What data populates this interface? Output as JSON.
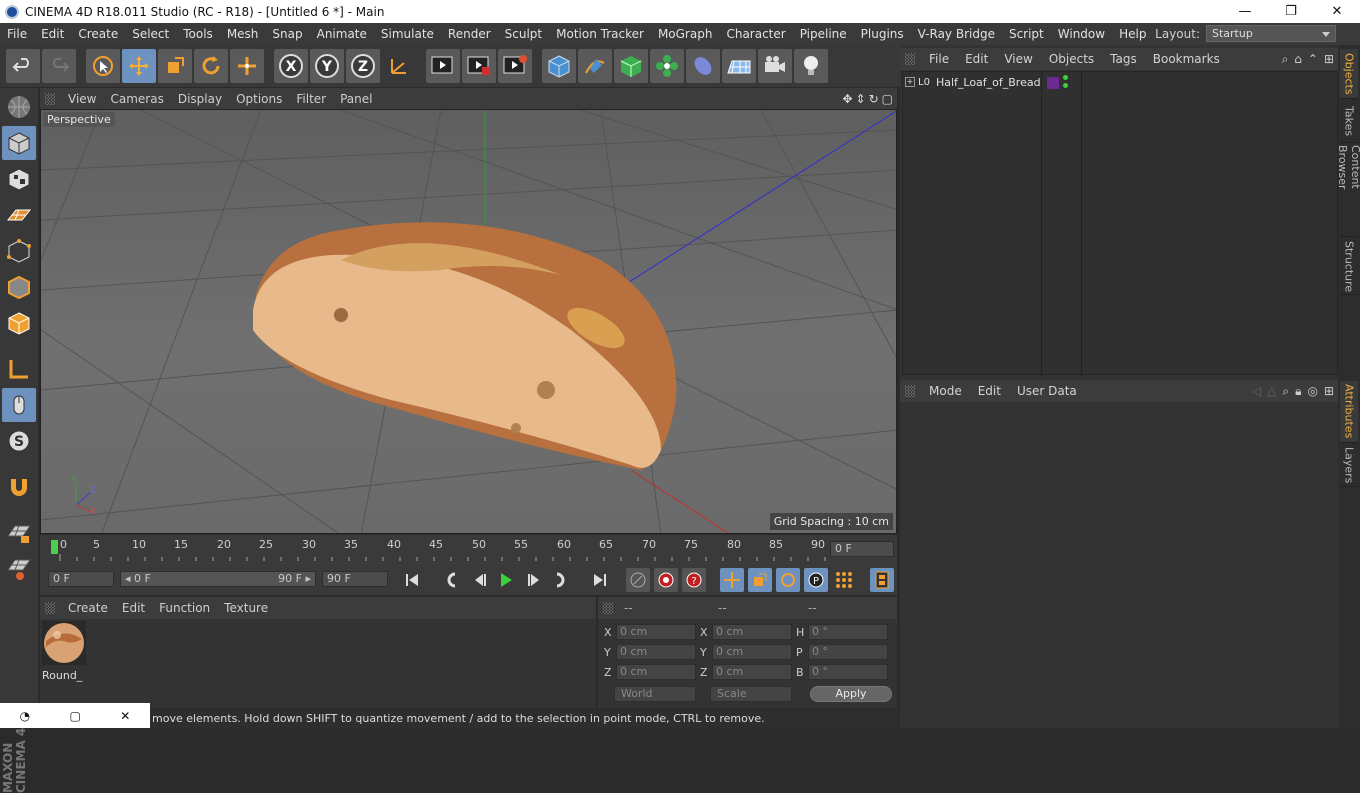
{
  "window": {
    "title": "CINEMA 4D R18.011 Studio (RC - R18) - [Untitled 6 *] - Main",
    "buttons": [
      "—",
      "❐",
      "✕"
    ]
  },
  "menubar": {
    "items": [
      "File",
      "Edit",
      "Create",
      "Select",
      "Tools",
      "Mesh",
      "Snap",
      "Animate",
      "Simulate",
      "Render",
      "Sculpt",
      "Motion Tracker",
      "MoGraph",
      "Character",
      "Pipeline",
      "Plugins",
      "V-Ray Bridge",
      "Script",
      "Window",
      "Help"
    ],
    "layout_label": "Layout:",
    "layout_value": "Startup"
  },
  "toolbar": {
    "icons": [
      "undo-icon",
      "redo-icon",
      "select-icon",
      "move-icon",
      "scale-icon",
      "rotate-icon",
      "live-selection-icon",
      "x-axis-icon",
      "y-axis-icon",
      "z-axis-icon",
      "coordinate-system-icon",
      "render-view-icon",
      "render-picture-viewer-icon",
      "edit-render-settings-icon",
      "cube-icon",
      "pen-icon",
      "subdivision-icon",
      "cloner-icon",
      "deformer-icon",
      "floor-icon",
      "camera-icon",
      "light-icon"
    ],
    "axis_labels": [
      "X",
      "Y",
      "Z"
    ]
  },
  "left_toolbar": {
    "icons": [
      "make-editable-icon",
      "model-mode-icon",
      "texture-mode-icon",
      "workplane-icon",
      "points-mode-icon",
      "edges-mode-icon",
      "polygons-mode-icon",
      "axis-mode-icon",
      "tweak-mode-icon",
      "soft-selection-icon",
      "snap-icon",
      "locked-workplane-icon",
      "planar-workplane-icon"
    ],
    "brand": "MAXON CINEMA 4D"
  },
  "viewport": {
    "menu": [
      "View",
      "Cameras",
      "Display",
      "Options",
      "Filter",
      "Panel"
    ],
    "camera_label": "Perspective",
    "grid_info": "Grid Spacing : 10 cm",
    "axis_labels": [
      "Y",
      "Z",
      "X"
    ]
  },
  "timeline": {
    "ticks": [
      "0",
      "5",
      "10",
      "15",
      "20",
      "25",
      "30",
      "35",
      "40",
      "45",
      "50",
      "55",
      "60",
      "65",
      "70",
      "75",
      "80",
      "85",
      "90"
    ],
    "current_frame": "0 F",
    "start_field": "0 F",
    "range_start": "◂ 0 F",
    "range_end": "90 F ▸",
    "end_field": "90 F"
  },
  "materials": {
    "menu": [
      "Create",
      "Edit",
      "Function",
      "Texture"
    ],
    "items": [
      {
        "name": "Round_"
      }
    ]
  },
  "coordinates": {
    "headers": [
      "--",
      "--",
      "--"
    ],
    "rows": [
      {
        "l1": "X",
        "v1": "0 cm",
        "l2": "X",
        "v2": "0 cm",
        "l3": "H",
        "v3": "0 °"
      },
      {
        "l1": "Y",
        "v1": "0 cm",
        "l2": "Y",
        "v2": "0 cm",
        "l3": "P",
        "v3": "0 °"
      },
      {
        "l1": "Z",
        "v1": "0 cm",
        "l2": "Z",
        "v2": "0 cm",
        "l3": "B",
        "v3": "0 °"
      }
    ],
    "world": "World",
    "scale": "Scale",
    "apply": "Apply"
  },
  "status": "move elements. Hold down SHIFT to quantize movement / add to the selection in point mode, CTRL to remove.",
  "object_manager": {
    "menu": [
      "File",
      "Edit",
      "View",
      "Objects",
      "Tags",
      "Bookmarks"
    ],
    "objects": [
      {
        "name": "Half_Loaf_of_Bread"
      }
    ]
  },
  "attribute_manager": {
    "menu": [
      "Mode",
      "Edit",
      "User Data"
    ]
  },
  "side_tabs": {
    "top": [
      "Objects",
      "Takes",
      "Content Browser",
      "Structure"
    ],
    "bottom": [
      "Attributes",
      "Layers"
    ]
  },
  "colors": {
    "accent": "#6d92c0",
    "highlight_tab": "#f0b040",
    "bread_crust": "#b8703e",
    "bread_crumb": "#e8b98a"
  }
}
